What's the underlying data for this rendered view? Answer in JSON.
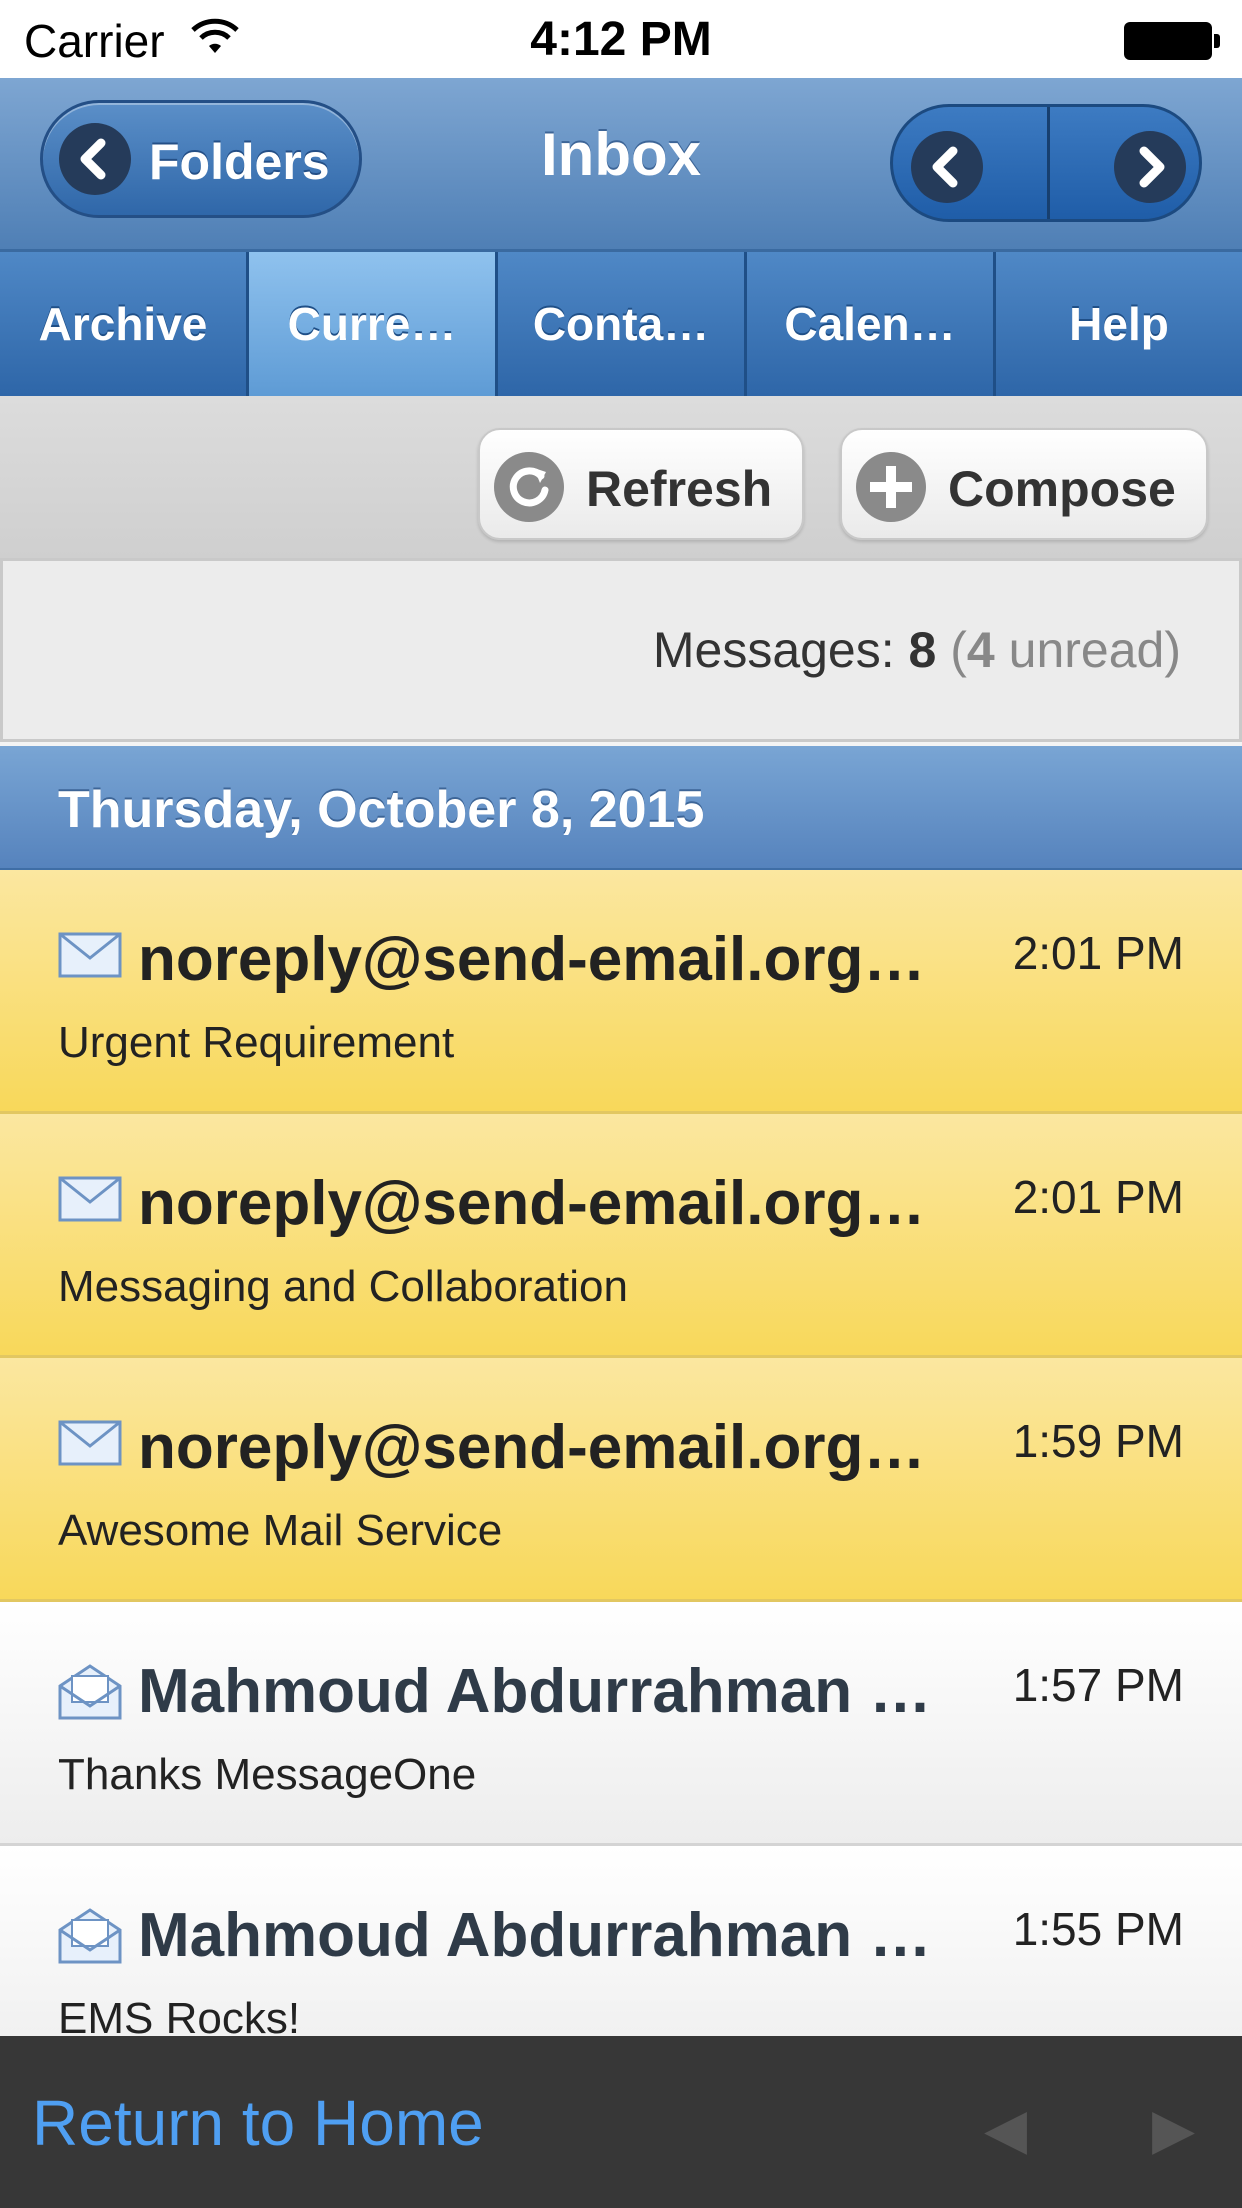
{
  "status_bar": {
    "carrier": "Carrier",
    "time": "4:12 PM"
  },
  "header": {
    "folders_label": "Folders",
    "title": "Inbox"
  },
  "tabs": [
    {
      "label": "Archive",
      "active": false
    },
    {
      "label": "Curre…",
      "active": true
    },
    {
      "label": "Conta…",
      "active": false
    },
    {
      "label": "Calen…",
      "active": false
    },
    {
      "label": "Help",
      "active": false
    }
  ],
  "toolbar": {
    "refresh_label": "Refresh",
    "compose_label": "Compose"
  },
  "summary": {
    "prefix": "Messages:",
    "total": "8",
    "open_paren": "(",
    "unread_count": "4",
    "unread_word": "unread",
    "close_paren": ")"
  },
  "date_header": "Thursday, October 8, 2015",
  "messages": [
    {
      "sender": "noreply@send-email.org …",
      "time": "2:01 PM",
      "subject": "Urgent Requirement",
      "unread": true
    },
    {
      "sender": "noreply@send-email.org …",
      "time": "2:01 PM",
      "subject": "Messaging and Collaboration",
      "unread": true
    },
    {
      "sender": "noreply@send-email.org …",
      "time": "1:59 PM",
      "subject": "Awesome Mail Service",
      "unread": true
    },
    {
      "sender": "Mahmoud Abdurrahman …",
      "time": "1:57 PM",
      "subject": "Thanks MessageOne",
      "unread": false
    },
    {
      "sender": "Mahmoud Abdurrahman …",
      "time": "1:55 PM",
      "subject": "EMS Rocks!",
      "unread": false
    }
  ],
  "footer": {
    "home_label": "Return to Home",
    "prev_glyph": "◀",
    "next_glyph": "▶"
  },
  "colors": {
    "header_blue": "#5b8fc8",
    "unread_yellow": "#f8d85a",
    "link_blue": "#4f9ff2",
    "footer_bg": "#373737"
  }
}
